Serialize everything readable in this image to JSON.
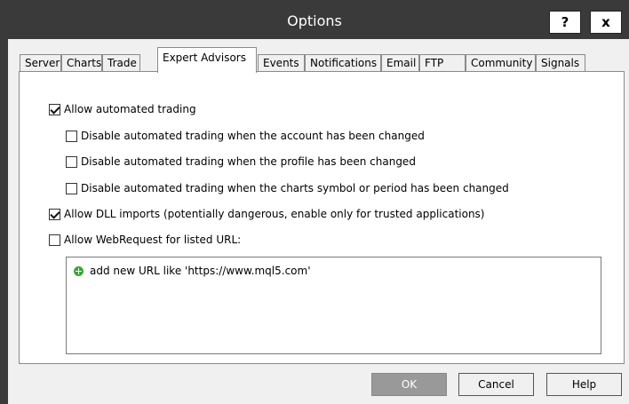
{
  "window": {
    "title": "Options",
    "help_label": "?",
    "close_label": "x"
  },
  "tabs": [
    {
      "label": "Server"
    },
    {
      "label": "Charts"
    },
    {
      "label": "Trade"
    },
    {
      "label": "Expert Advisors",
      "active": true
    },
    {
      "label": "Events"
    },
    {
      "label": "Notifications"
    },
    {
      "label": "Email"
    },
    {
      "label": "FTP"
    },
    {
      "label": "Community"
    },
    {
      "label": "Signals"
    }
  ],
  "options": {
    "allow_automated_trading": {
      "label": "Allow automated trading",
      "checked": true
    },
    "disable_account_changed": {
      "label": "Disable automated trading when the account has been changed",
      "checked": false
    },
    "disable_profile_changed": {
      "label": "Disable automated trading when the profile has been changed",
      "checked": false
    },
    "disable_symbol_changed": {
      "label": "Disable automated trading when the charts symbol or period has been changed",
      "checked": false
    },
    "allow_dll_imports": {
      "label": "Allow DLL imports (potentially dangerous, enable only for trusted applications)",
      "checked": true
    },
    "allow_webrequest": {
      "label": "Allow WebRequest for listed URL:",
      "checked": false
    }
  },
  "url_list": {
    "add_new_label": "add new URL like 'https://www.mql5.com'"
  },
  "buttons": {
    "ok": "OK",
    "cancel": "Cancel",
    "help": "Help"
  }
}
